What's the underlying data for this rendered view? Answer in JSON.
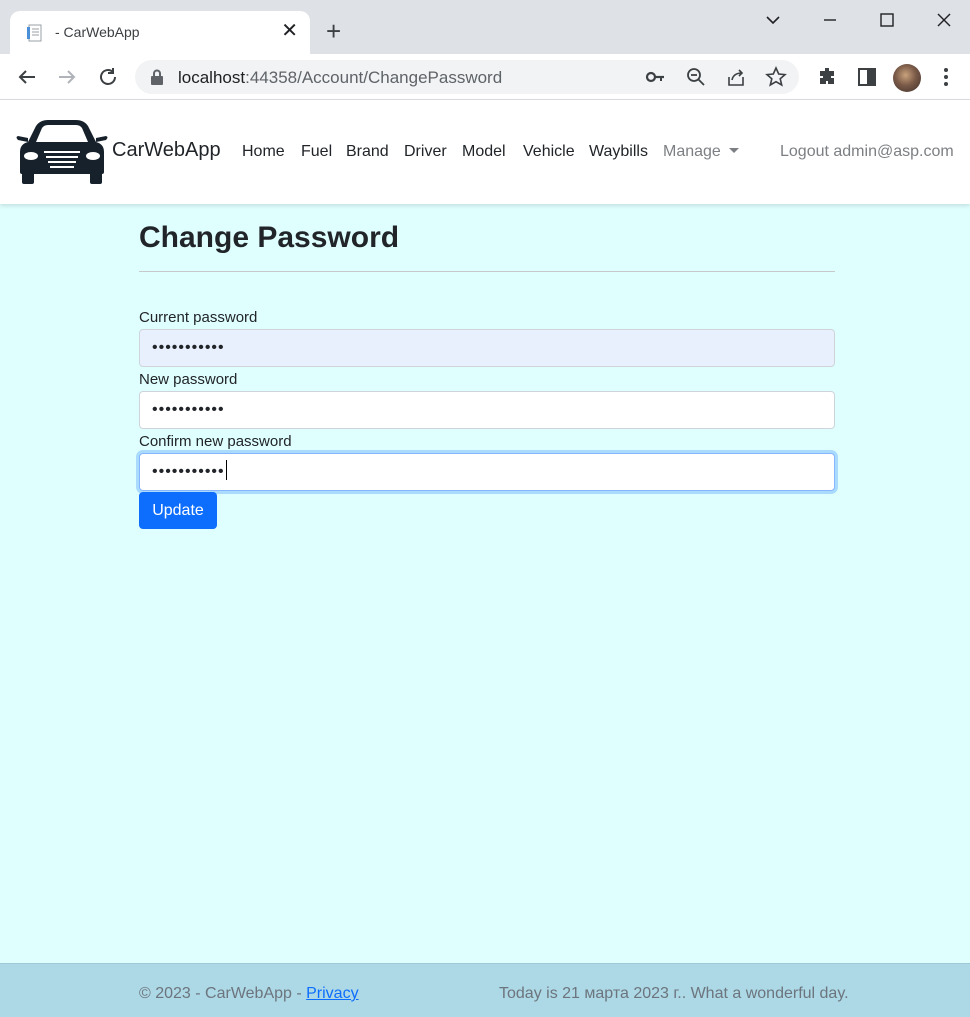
{
  "browser": {
    "tab_title": "- CarWebApp",
    "url_host": "localhost",
    "url_path": ":44358/Account/ChangePassword"
  },
  "navbar": {
    "brand": "CarWebApp",
    "links": [
      "Home",
      "Fuel",
      "Brand",
      "Driver",
      "Model",
      "Vehicle",
      "Waybills"
    ],
    "manage": "Manage",
    "logout": "Logout admin@asp.com"
  },
  "page": {
    "title": "Change Password",
    "current_label": "Current password",
    "current_value": "•••••••••••",
    "new_label": "New password",
    "new_value": "•••••••••••",
    "confirm_label": "Confirm new password",
    "confirm_value": "•••••••••••",
    "submit": "Update"
  },
  "footer": {
    "copyright": "© 2023 - CarWebApp - ",
    "privacy": "Privacy",
    "date_text": "Today is 21 марта 2023 г.. What a wonderful day."
  },
  "colors": {
    "page_bg": "#dffffe",
    "footer_bg": "#add8e6",
    "primary": "#0d6efd"
  }
}
